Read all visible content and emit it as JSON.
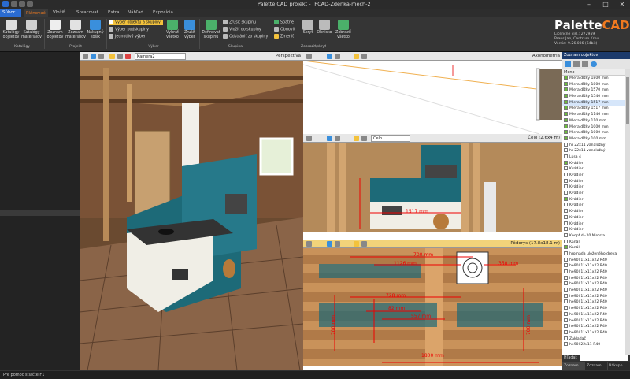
{
  "window": {
    "title": "Palette CAD projekt - [PCAD-Zdenka-mech-2]"
  },
  "tabs": [
    "Súbor",
    "Plánovač",
    "Vložiť",
    "Spracovať",
    "Extra",
    "Náhľad",
    "Exposícia"
  ],
  "ribbon": {
    "catalog": {
      "btn1": "Katalógy objektov",
      "btn2": "Katalógy materiálov",
      "group": "Katalógy"
    },
    "project": {
      "btn1": "Zoznam objektov",
      "btn2": "Zoznam materiálov",
      "btn3": "Nákupný košík",
      "group": "Projekt"
    },
    "selection": {
      "opt1": "Výber objektu a skupiny",
      "opt2": "Výber podskupiny",
      "opt3": "Jednotlivý výber",
      "btn1": "Vybrať všetko",
      "btn2": "Zrušiť výber",
      "group": "Výber"
    },
    "groups": {
      "btn1": "Definovať skupinu",
      "opt1": "Zrušiť skupinu",
      "opt2": "Vložiť do skupiny",
      "opt3": "Odstrániť zo skupiny",
      "group": "Skupina"
    },
    "view": {
      "opt1": "Späťne",
      "opt2": "Obnoviť",
      "opt3": "Zmeniť",
      "btn1": "Skryť",
      "btn2": "Ohnisko",
      "btn3": "Zobraziť všetko",
      "group": "Zobraziť/skryť"
    }
  },
  "logo": {
    "brand_a": "Palette",
    "brand_b": "CAD",
    "line1": "Licenčné čísl.: 272959",
    "line2": "Praus Jan, Centrum Krbu",
    "line3": "Verzia: 9.26.036 (64bit)"
  },
  "viewports": {
    "perspective": {
      "camera": "Kamera2",
      "label": "Perspektíva"
    },
    "axonometric": {
      "label": "Axonometria"
    },
    "front": {
      "view": "Čelo",
      "label": "Čelo",
      "scale": "(2.6x4 m)"
    },
    "plan": {
      "label": "Pôdorys",
      "scale": "(17.8x18.1 m)"
    }
  },
  "dimensions": {
    "front_width": "1517 mm",
    "plan_d1": "700 mm",
    "plan_d2": "1126 mm",
    "plan_d3": "350 mm",
    "plan_d4": "728 mm",
    "plan_d5": "82 mm",
    "plan_d6": "557 mm",
    "plan_d7": "700 mm",
    "plan_d8": "700 mm",
    "plan_d9": "1800 mm"
  },
  "right_panel": {
    "title": "Zoznam objektov",
    "column": "Meno",
    "items": [
      "Miera dĺžky 1800 mm",
      "Miera dĺžky 1800 mm",
      "Miera dĺžky 1570 mm",
      "Miera dĺžky 1540 mm",
      "Miera dĺžky 1517 mm",
      "Miera dĺžky 1517 mm",
      "Miera dĺžky 1146 mm",
      "Miera dĺžky 110 mm",
      "Miera dĺžky 1000 mm",
      "Miera dĺžky 1000 mm",
      "Miera dĺžky 100 mm",
      "hr 22x11 vanaložný",
      "hr 22x11 vanaložný",
      "Lúsa 4",
      "Kvádier",
      "Kvádier",
      "Kvádier",
      "Kvádier",
      "Kvádier",
      "Kvádier",
      "Kvádier",
      "Kvádier",
      "Kvádier",
      "Kvádier",
      "Kvádier",
      "Kvádier",
      "Knopf d=20 Nirosta",
      "Kanál",
      "Kanál",
      "hromada uloženého dreva",
      "he90l 11x11x22 R40",
      "he90l 11x11x22 R40",
      "he90l 11x11x22 R40",
      "he90l 11x11x22 R40",
      "he90l 11x11x22 R40",
      "he90l 11x11x22 R40",
      "he90l 11x11x22 R40",
      "he90l 11x11x22 R40",
      "he90l 11x11x22 R40",
      "he90l 11x11x22 R40",
      "he90l 11x11x22 R40",
      "he90l 11x11x22 R40",
      "he90l 11x11x22 R40",
      "Zakladač",
      "he90l 22x11 R40"
    ],
    "search_label": "Hľadaj:",
    "bottom_tabs": [
      "Zoznam ...",
      "Zoznam ...",
      "Nákupn..."
    ]
  },
  "status": {
    "text": "Pre pomoc stlačte F1"
  }
}
